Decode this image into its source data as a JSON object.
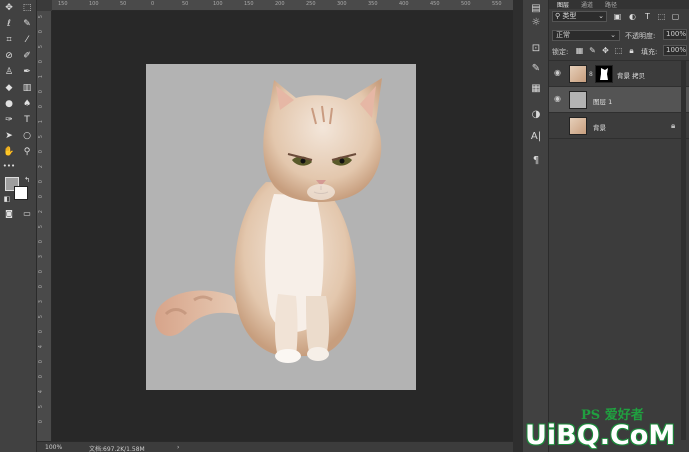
{
  "ruler": {
    "top_ticks": [
      "150",
      "100",
      "50",
      "0",
      "50",
      "100",
      "150",
      "200",
      "250",
      "300",
      "350",
      "400",
      "450",
      "500",
      "550"
    ],
    "left_ticks": [
      "5",
      "0",
      "5",
      "0",
      "1",
      "0",
      "0",
      "1",
      "5",
      "0",
      "2",
      "0",
      "0",
      "2",
      "5",
      "0",
      "3",
      "0",
      "0",
      "3",
      "5",
      "0",
      "4",
      "0",
      "0",
      "4",
      "5",
      "0"
    ]
  },
  "status": {
    "zoom": "100%",
    "doc": "文档:697.2K/1.58M"
  },
  "panel": {
    "tabs": [
      "图层",
      "通道",
      "路径"
    ],
    "filter_label": "类型",
    "blend_mode": "正常",
    "opacity_label": "不透明度:",
    "opacity_value": "100%",
    "lock_label": "锁定:",
    "fill_label": "填充:",
    "fill_value": "100%",
    "layers": [
      {
        "name": "背景 拷贝"
      },
      {
        "name": "图层 1"
      },
      {
        "name": "背景"
      }
    ]
  },
  "watermark": {
    "line1": "PS 爱好者",
    "line2": "UiBQ.CoM"
  },
  "colors": {
    "canvas_bg": "#282828",
    "doc_bg": "#b3b3b3",
    "selected_layer": "#545454",
    "watermark_green": "#20a040"
  }
}
